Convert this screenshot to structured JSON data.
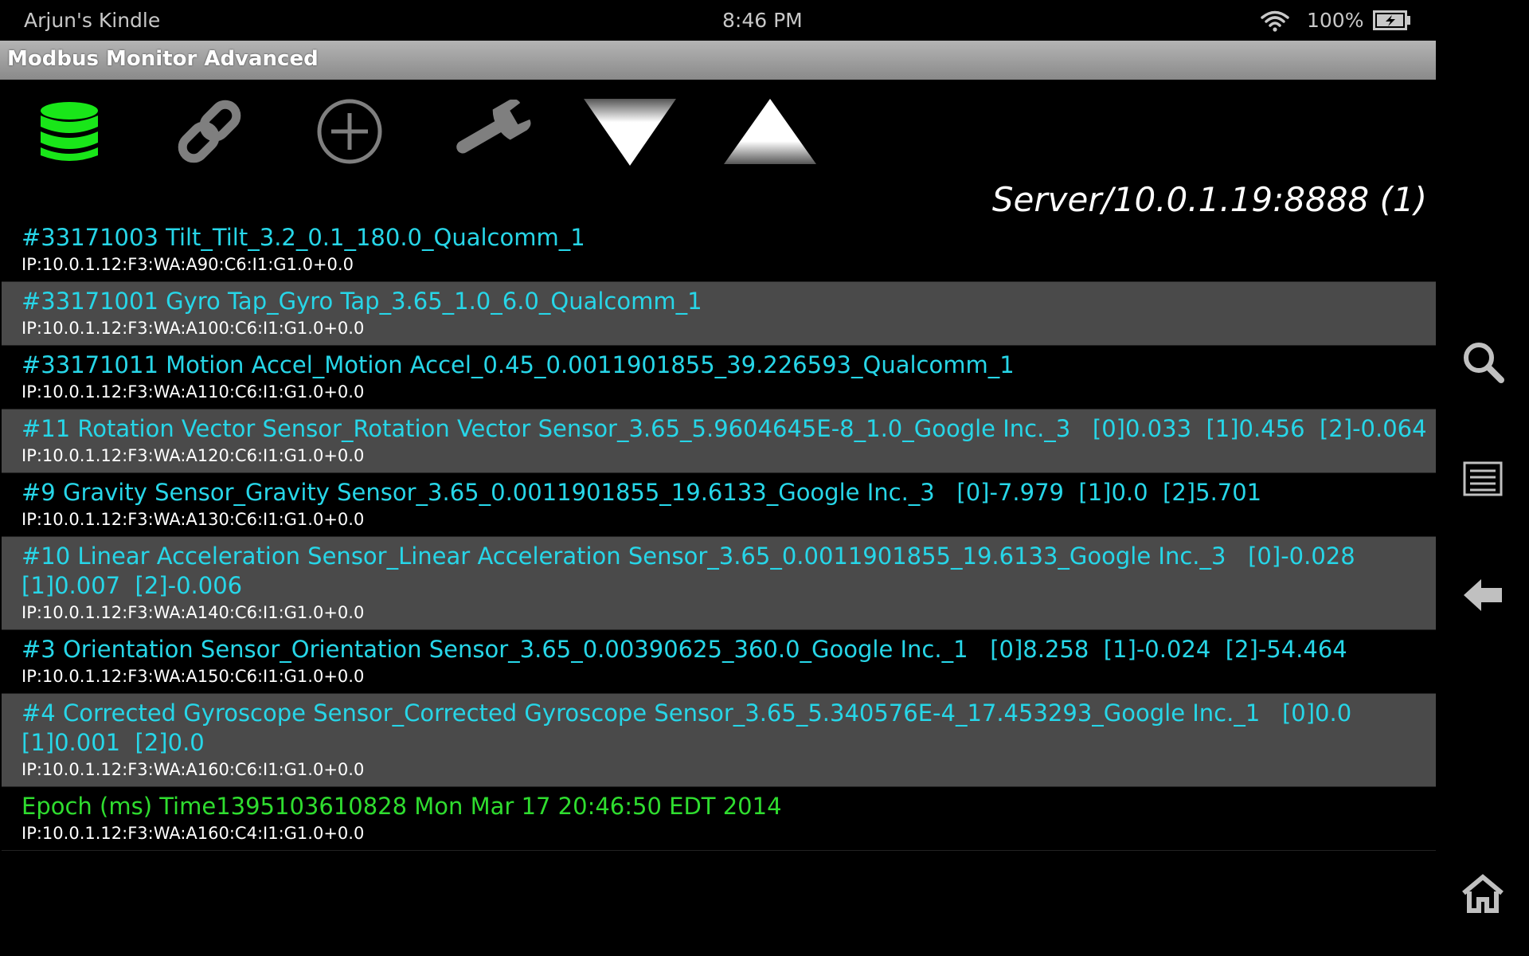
{
  "status_bar": {
    "device_name": "Arjun's Kindle",
    "time": "8:46 PM",
    "battery": "100%"
  },
  "app": {
    "title": "Modbus Monitor Advanced",
    "server": "Server/10.0.1.19:8888 (1)"
  },
  "toolbar": {
    "accent_color": "#19e619",
    "buttons": [
      {
        "icon": "database-icon"
      },
      {
        "icon": "link-icon"
      },
      {
        "icon": "add-circle-icon"
      },
      {
        "icon": "wrench-icon"
      },
      {
        "icon": "arrow-down-icon"
      },
      {
        "icon": "arrow-up-icon"
      }
    ]
  },
  "rows": [
    {
      "title": "#33171003 Tilt_Tilt_3.2_0.1_180.0_Qualcomm_1",
      "addr": "IP:10.0.1.12:F3:WA:A90:C6:I1:G1.0+0.0"
    },
    {
      "title": "#33171001 Gyro Tap_Gyro Tap_3.65_1.0_6.0_Qualcomm_1",
      "addr": "IP:10.0.1.12:F3:WA:A100:C6:I1:G1.0+0.0"
    },
    {
      "title": "#33171011 Motion Accel_Motion Accel_0.45_0.0011901855_39.226593_Qualcomm_1",
      "addr": "IP:10.0.1.12:F3:WA:A110:C6:I1:G1.0+0.0"
    },
    {
      "title": "#11 Rotation Vector Sensor_Rotation Vector Sensor_3.65_5.9604645E-8_1.0_Google Inc._3   [0]0.033  [1]0.456  [2]-0.064",
      "addr": "IP:10.0.1.12:F3:WA:A120:C6:I1:G1.0+0.0"
    },
    {
      "title": "#9 Gravity Sensor_Gravity Sensor_3.65_0.0011901855_19.6133_Google Inc._3   [0]-7.979  [1]0.0  [2]5.701",
      "addr": "IP:10.0.1.12:F3:WA:A130:C6:I1:G1.0+0.0"
    },
    {
      "title": "#10 Linear Acceleration Sensor_Linear Acceleration Sensor_3.65_0.0011901855_19.6133_Google Inc._3   [0]-0.028  [1]0.007  [2]-0.006",
      "addr": "IP:10.0.1.12:F3:WA:A140:C6:I1:G1.0+0.0"
    },
    {
      "title": "#3 Orientation Sensor_Orientation Sensor_3.65_0.00390625_360.0_Google Inc._1   [0]8.258  [1]-0.024  [2]-54.464",
      "addr": "IP:10.0.1.12:F3:WA:A150:C6:I1:G1.0+0.0"
    },
    {
      "title": "#4 Corrected Gyroscope Sensor_Corrected Gyroscope Sensor_3.65_5.340576E-4_17.453293_Google Inc._1   [0]0.0  [1]0.001  [2]0.0",
      "addr": "IP:10.0.1.12:F3:WA:A160:C6:I1:G1.0+0.0"
    },
    {
      "title": "Epoch (ms) Time1395103610828 Mon Mar 17 20:46:50 EDT 2014",
      "addr": "IP:10.0.1.12:F3:WA:A160:C4:I1:G1.0+0.0"
    }
  ],
  "colors": {
    "row_title": "#27d6e8",
    "epoch_title": "#2fdd2f",
    "shaded_row": "#4a4a4a"
  },
  "nav": [
    {
      "icon": "search-icon"
    },
    {
      "icon": "menu-icon"
    },
    {
      "icon": "back-arrow-icon"
    },
    {
      "icon": "home-icon"
    }
  ]
}
